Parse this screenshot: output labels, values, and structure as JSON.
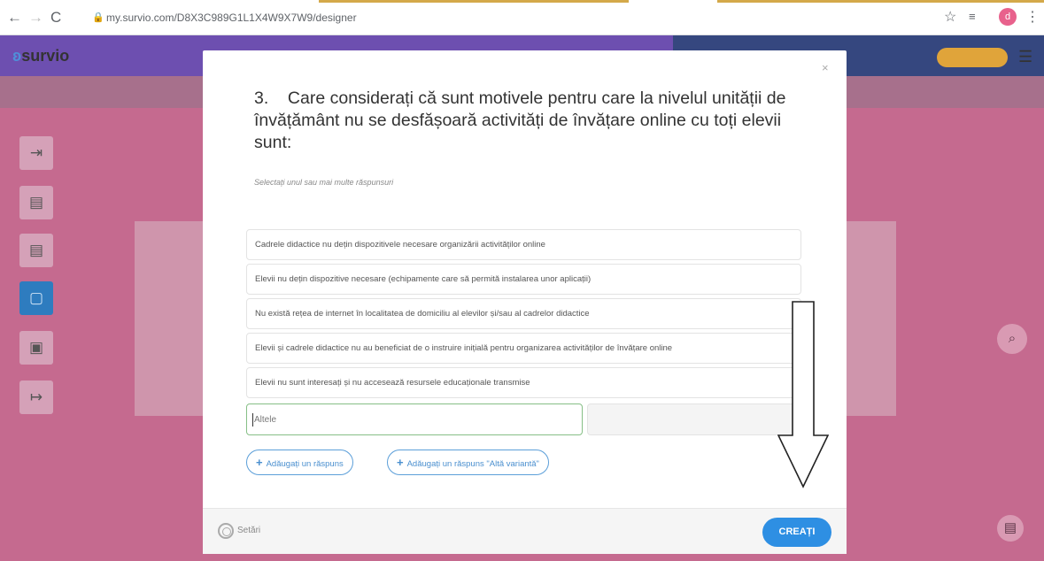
{
  "browser": {
    "url": "my.survio.com/D8X3C989G1L1X4W9X7W9/designer",
    "profile_initial": "d"
  },
  "app": {
    "logo": "survio"
  },
  "modal": {
    "close": "×",
    "question": "3.    Care considerați că sunt motivele pentru care la nivelul unității de învățământ nu se desfășoară activități de învățare online cu toți elevii sunt:",
    "subtitle": "Selectați unul sau mai multe răspunsuri",
    "options": [
      "Cadrele didactice nu dețin dispozitivele necesare organizării activităților online",
      "Elevii nu dețin dispozitive necesare (echipamente care să permită instalarea unor aplicații)",
      "Nu există rețea de  internet în localitatea de domiciliu al elevilor și/sau al cadrelor didactice",
      "Elevii și cadrele didactice nu au beneficiat de o instruire inițială pentru organizarea activităților de învățare online",
      "Elevii nu sunt interesați și nu accesează resursele educaționale transmise"
    ],
    "other_placeholder": "Altele",
    "add_answer": "Adăugați un răspuns",
    "add_other_answer": "Adăugați un răspuns \"Altă variantă\"",
    "settings": "Setări",
    "create": "CREAȚI"
  },
  "colors": {
    "accent": "#2e8fe3",
    "backdrop": "#c56a8f",
    "topbar": "#6d4fb0"
  }
}
